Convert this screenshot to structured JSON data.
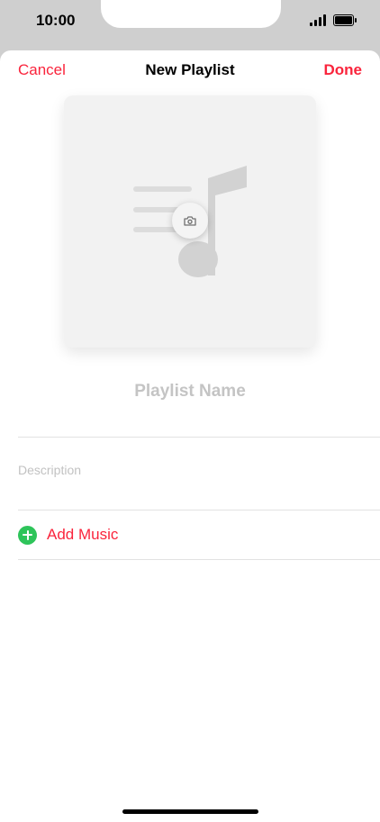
{
  "status_bar": {
    "time": "10:00",
    "icons": [
      "signal-icon",
      "battery-icon"
    ]
  },
  "nav": {
    "cancel_label": "Cancel",
    "title": "New Playlist",
    "done_label": "Done"
  },
  "artwork": {
    "placeholder_icon": "music-note-list-icon",
    "camera_icon": "camera-icon"
  },
  "form": {
    "name_placeholder": "Playlist Name",
    "description_placeholder": "Description"
  },
  "add_music": {
    "label": "Add Music",
    "icon": "plus-circle-icon"
  },
  "colors": {
    "accent": "#fa243c",
    "add_green": "#2ec45a",
    "placeholder_gray": "#c4c4c4"
  }
}
